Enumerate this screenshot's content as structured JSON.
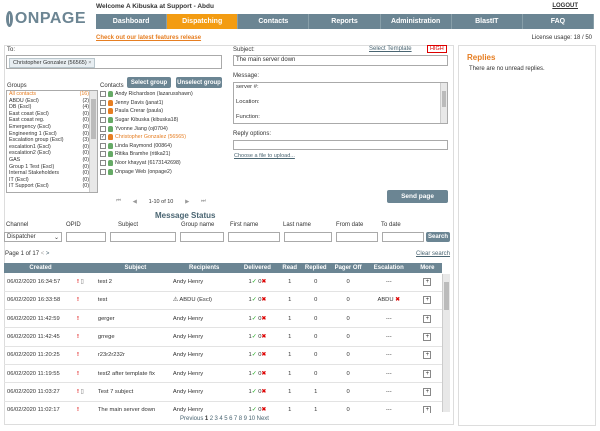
{
  "header": {
    "logo_text": "ONPAGE",
    "welcome": "Welcome A Kibuska at Support - Abdu",
    "logout": "LOGOUT",
    "nav": [
      "Dashboard",
      "Dispatching",
      "Contacts",
      "Reports",
      "Administration",
      "BlastIT",
      "FAQ"
    ],
    "active_nav": "Dispatching",
    "promo": "Check out our latest features release",
    "license": "License usage: 18 / 50"
  },
  "compose": {
    "to_label": "To:",
    "to_chip": "Christopher Gonzalez (56565)",
    "subject_label": "Subject:",
    "select_template": "Select Template",
    "priority": "HIGH",
    "subject_value": "The main server down",
    "message_label": "Message:",
    "message_lines": [
      "server #:",
      "",
      "Location:",
      "",
      "Function:"
    ],
    "reply_options_label": "Reply options:",
    "choose_file": "Choose a file to upload...",
    "send_button": "Send page"
  },
  "groups": {
    "label": "Groups",
    "items": [
      {
        "name": "All contacts",
        "count": "(16)"
      },
      {
        "name": "ABDU (Escl)",
        "count": "(2)"
      },
      {
        "name": "DB (Escl)",
        "count": "(4)"
      },
      {
        "name": "East coast (Escl)",
        "count": "(0)"
      },
      {
        "name": "East coast reg.",
        "count": "(0)"
      },
      {
        "name": "Emergency (Escl)",
        "count": "(0)"
      },
      {
        "name": "Engineering 1 (Escl)",
        "count": "(0)"
      },
      {
        "name": "Escalation group (Escl)",
        "count": "(3)"
      },
      {
        "name": "escalation1 (Escl)",
        "count": "(0)"
      },
      {
        "name": "escalation2 (Escl)",
        "count": "(0)"
      },
      {
        "name": "GAS",
        "count": "(0)"
      },
      {
        "name": "Group 1 Test (Escl)",
        "count": "(0)"
      },
      {
        "name": "Internal Stakeholders",
        "count": "(0)"
      },
      {
        "name": "IT (Escl)",
        "count": "(0)"
      },
      {
        "name": "IT Support (Escl)",
        "count": "(0)"
      }
    ]
  },
  "contacts": {
    "label": "Contacts",
    "select_group": "Select group",
    "unselect_group": "Unselect group",
    "items": [
      {
        "name": "Andy Richardson (lazarusshawn)",
        "checked": false,
        "color": "green"
      },
      {
        "name": "Jenny Davis (janat1)",
        "checked": false,
        "color": "orange"
      },
      {
        "name": "Paula Crerar (paula)",
        "checked": false,
        "color": "orange"
      },
      {
        "name": "Sugar Kibuska (kibuska18)",
        "checked": false,
        "color": "green"
      },
      {
        "name": "Yvonne Jiang (oj0704)",
        "checked": false,
        "color": "green"
      },
      {
        "name": "Christopher Gonzalez (56565)",
        "checked": true,
        "color": "orange"
      },
      {
        "name": "Linda Raymond (00864)",
        "checked": false,
        "color": "green"
      },
      {
        "name": "Ritika Bramhe (ritika21)",
        "checked": false,
        "color": "green"
      },
      {
        "name": "Noor khayyat (6173142698)",
        "checked": false,
        "color": "green"
      },
      {
        "name": "Onpage Web (onpage2)",
        "checked": false,
        "color": "green"
      }
    ],
    "pager": "1-10 of 10"
  },
  "replies": {
    "title": "Replies",
    "empty": "There are no unread replies."
  },
  "status": {
    "title": "Message Status",
    "filters": {
      "channel_label": "Channel",
      "channel_value": "Dispatcher",
      "opid_label": "OPID",
      "subject_label": "Subject",
      "group_label": "Group name",
      "first_label": "First name",
      "last_label": "Last name",
      "from_label": "From date",
      "to_label": "To date",
      "search": "Search"
    },
    "page_info": "Page 1 of 17",
    "clear_search": "Clear search",
    "columns": [
      "Created",
      "Subject",
      "Recipients",
      "Delivered",
      "Read",
      "Replied",
      "Pager Off",
      "Escalation",
      "More"
    ],
    "rows": [
      {
        "created": "06/02/2020 16:34:57",
        "subject": "test 2",
        "recipient": "Andy Henry",
        "delivered": "1",
        "undel": "0",
        "read": "1",
        "replied": "0",
        "pager_off": "0",
        "escalation": "---",
        "esc_x": false,
        "attach": true,
        "group": false
      },
      {
        "created": "06/02/2020 16:33:58",
        "subject": "test",
        "recipient": "ABDU (Escl)",
        "delivered": "1",
        "undel": "0",
        "read": "1",
        "replied": "0",
        "pager_off": "0",
        "escalation": "ABDU",
        "esc_x": true,
        "attach": false,
        "group": true
      },
      {
        "created": "06/02/2020 11:42:59",
        "subject": "gerger",
        "recipient": "Andy Henry",
        "delivered": "1",
        "undel": "0",
        "read": "1",
        "replied": "0",
        "pager_off": "0",
        "escalation": "---",
        "esc_x": false,
        "attach": false,
        "group": false
      },
      {
        "created": "06/02/2020 11:42:45",
        "subject": "grrege",
        "recipient": "Andy Henry",
        "delivered": "1",
        "undel": "0",
        "read": "1",
        "replied": "0",
        "pager_off": "0",
        "escalation": "---",
        "esc_x": false,
        "attach": false,
        "group": false
      },
      {
        "created": "06/02/2020 11:20:25",
        "subject": "r23r2r232r",
        "recipient": "Andy Henry",
        "delivered": "1",
        "undel": "0",
        "read": "1",
        "replied": "0",
        "pager_off": "0",
        "escalation": "---",
        "esc_x": false,
        "attach": false,
        "group": false
      },
      {
        "created": "06/02/2020 11:19:55",
        "subject": "test2 after template fix",
        "recipient": "Andy Henry",
        "delivered": "1",
        "undel": "0",
        "read": "1",
        "replied": "0",
        "pager_off": "0",
        "escalation": "---",
        "esc_x": false,
        "attach": false,
        "group": false
      },
      {
        "created": "06/02/2020 11:03:27",
        "subject": "Test 7 subject",
        "recipient": "Andy Henry",
        "delivered": "1",
        "undel": "0",
        "read": "1",
        "replied": "1",
        "pager_off": "0",
        "escalation": "---",
        "esc_x": false,
        "attach": true,
        "group": false
      },
      {
        "created": "06/02/2020 11:02:17",
        "subject": "The main server down",
        "recipient": "Andy Henry",
        "delivered": "1",
        "undel": "0",
        "read": "1",
        "replied": "1",
        "pager_off": "0",
        "escalation": "---",
        "esc_x": false,
        "attach": false,
        "group": false
      }
    ],
    "pages": {
      "prev": "Previous",
      "numbers": [
        "1",
        "2",
        "3",
        "4",
        "5",
        "6",
        "7",
        "8",
        "9",
        "10"
      ],
      "next": "Next"
    }
  }
}
